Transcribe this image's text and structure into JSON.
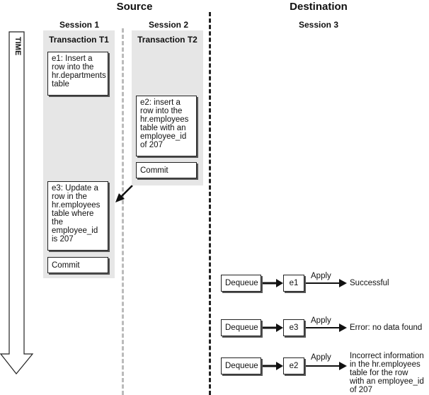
{
  "headers": {
    "source": "Source",
    "destination": "Destination"
  },
  "sessions": {
    "s1": "Session 1",
    "s2": "Session 2",
    "s3": "Session 3"
  },
  "time_label": "TIME",
  "transactions": {
    "t1": {
      "title": "Transaction T1",
      "events": [
        {
          "id": "e1",
          "lines": [
            "e1: Insert a",
            "row into the",
            "hr.departments",
            "table"
          ]
        },
        {
          "id": "e3",
          "lines": [
            "e3: Update a",
            "row in the",
            "hr.employees",
            "table where",
            "the",
            "employee_id",
            "is 207"
          ]
        }
      ],
      "commit": "Commit"
    },
    "t2": {
      "title": "Transaction T2",
      "events": [
        {
          "id": "e2",
          "lines": [
            "e2: insert a",
            "row into the",
            "hr.employees",
            "table with an",
            "employee_id",
            "of 207"
          ]
        }
      ],
      "commit": "Commit"
    }
  },
  "apply_rows": [
    {
      "dequeue": "Dequeue",
      "event": "e1",
      "action": "Apply",
      "result": [
        "Successful"
      ]
    },
    {
      "dequeue": "Dequeue",
      "event": "e3",
      "action": "Apply",
      "result": [
        "Error: no data found"
      ]
    },
    {
      "dequeue": "Dequeue",
      "event": "e2",
      "action": "Apply",
      "result": [
        "Incorrect information",
        "in the hr.employees",
        "table for the row",
        "with an employee_id",
        "of 207"
      ]
    }
  ]
}
